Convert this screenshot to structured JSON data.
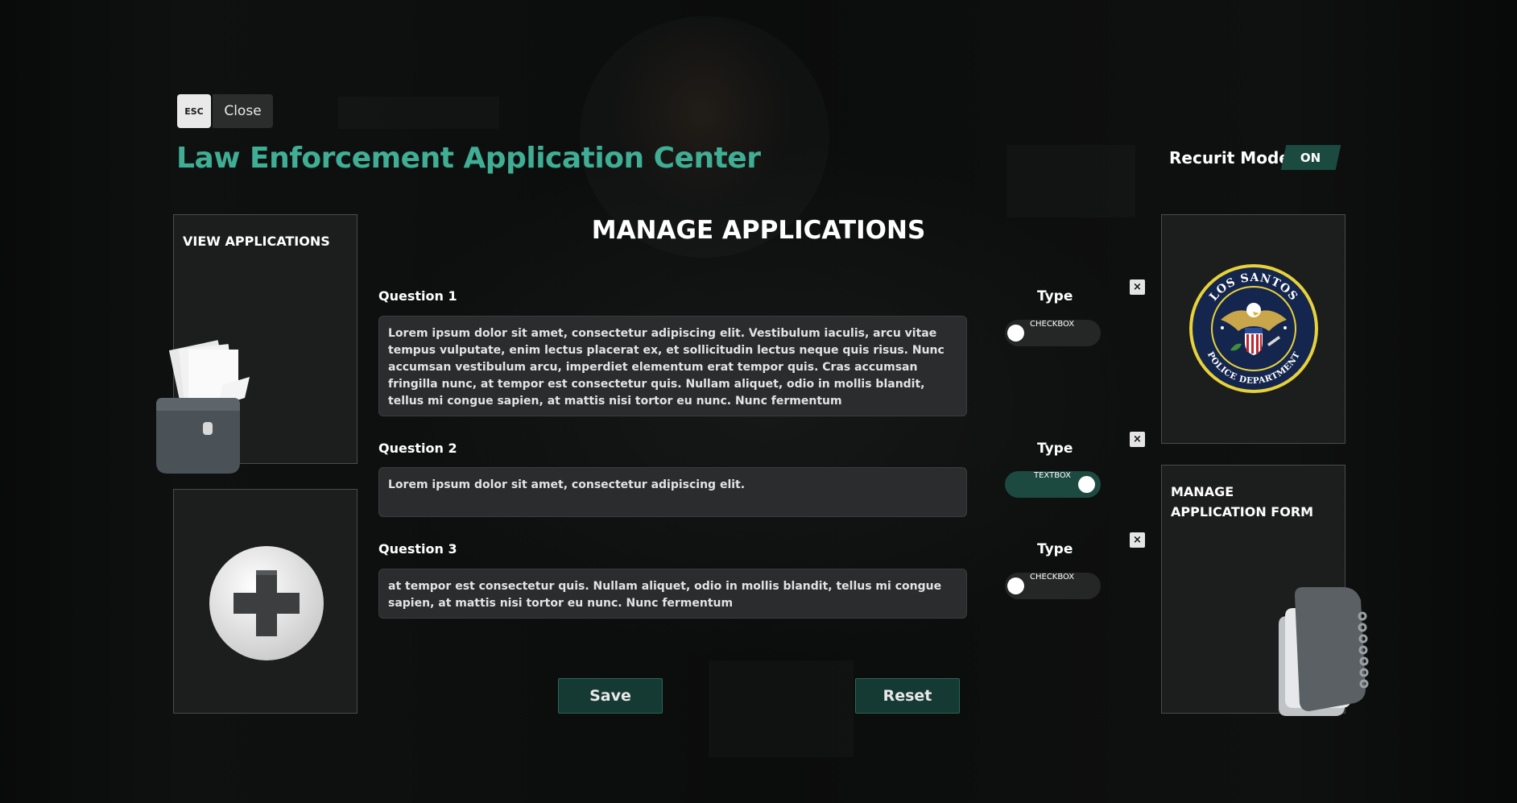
{
  "header": {
    "esc_key": "ESC",
    "close_label": "Close",
    "title": "Law Enforcement Application Center",
    "recruit_mode_label": "Recurit Mode",
    "recruit_mode_value": "ON"
  },
  "sidebar_left": {
    "view_applications_title": "VIEW APPLICATIONS"
  },
  "sidebar_right": {
    "manage_form_title": "MANAGE APPLICATION FORM",
    "seal_top_text": "LOS SANTOS",
    "seal_bottom_text": "POLICE DEPARTMENT"
  },
  "main": {
    "heading": "MANAGE APPLICATIONS",
    "type_label": "Type",
    "questions": [
      {
        "label": "Question 1",
        "text": "Lorem ipsum dolor sit amet, consectetur adipiscing elit. Vestibulum iaculis, arcu vitae tempus vulputate, enim lectus placerat ex, et sollicitudin lectus neque quis risus. Nunc accumsan vestibulum arcu, imperdiet elementum erat tempor quis. Cras accumsan fringilla nunc, at tempor est consectetur quis. Nullam aliquet, odio in mollis blandit, tellus mi congue sapien, at mattis nisi tortor eu nunc. Nunc fermentum",
        "type": "CHECKBOX"
      },
      {
        "label": "Question 2",
        "text": "Lorem ipsum dolor sit amet, consectetur adipiscing elit.",
        "type": "TEXTBOX"
      },
      {
        "label": "Question 3",
        "text": "at tempor est consectetur quis. Nullam aliquet, odio in mollis blandit, tellus mi congue sapien, at mattis nisi tortor eu nunc. Nunc fermentum",
        "type": "CHECKBOX"
      }
    ],
    "delete_glyph": "×",
    "save_label": "Save",
    "reset_label": "Reset"
  },
  "icons": {
    "folder": "folder-docs-icon",
    "add": "plus-circle-icon",
    "seal": "police-seal-icon",
    "notebook": "notebook-icon"
  },
  "colors": {
    "accent": "#3fae95",
    "toggle_on": "#1c4a40",
    "button_bg": "#153a33"
  }
}
